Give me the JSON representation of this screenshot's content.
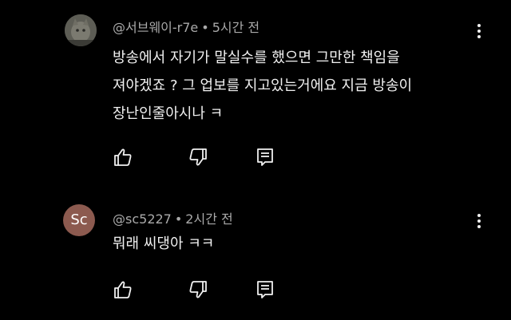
{
  "colors": {
    "background": "#000000",
    "text_primary": "#f1f1f1",
    "text_secondary": "#aaaaaa",
    "avatar_sc_bg": "#8c5a4f"
  },
  "comments": [
    {
      "avatar": {
        "type": "photo",
        "icon": "cat-photo-avatar"
      },
      "author": "@서브웨이-r7e",
      "separator": "•",
      "time": "5시간 전",
      "lines": [
        "방송에서 자기가 말실수를 했으면 그만한 책임을",
        "져야겠죠 ? 그 업보를 지고있는거에요 지금 방송이",
        "장난인줄아시나 ㅋ"
      ],
      "actions": {
        "like_icon": "thumbs-up-icon",
        "dislike_icon": "thumbs-down-icon",
        "reply_icon": "reply-icon",
        "more_icon": "more-vertical-icon"
      }
    },
    {
      "avatar": {
        "type": "letter",
        "text": "Sc"
      },
      "author": "@sc5227",
      "separator": "•",
      "time": "2시간 전",
      "lines": [
        "뭐래 씨댕아 ㅋㅋ"
      ],
      "actions": {
        "like_icon": "thumbs-up-icon",
        "dislike_icon": "thumbs-down-icon",
        "reply_icon": "reply-icon",
        "more_icon": "more-vertical-icon"
      }
    }
  ]
}
